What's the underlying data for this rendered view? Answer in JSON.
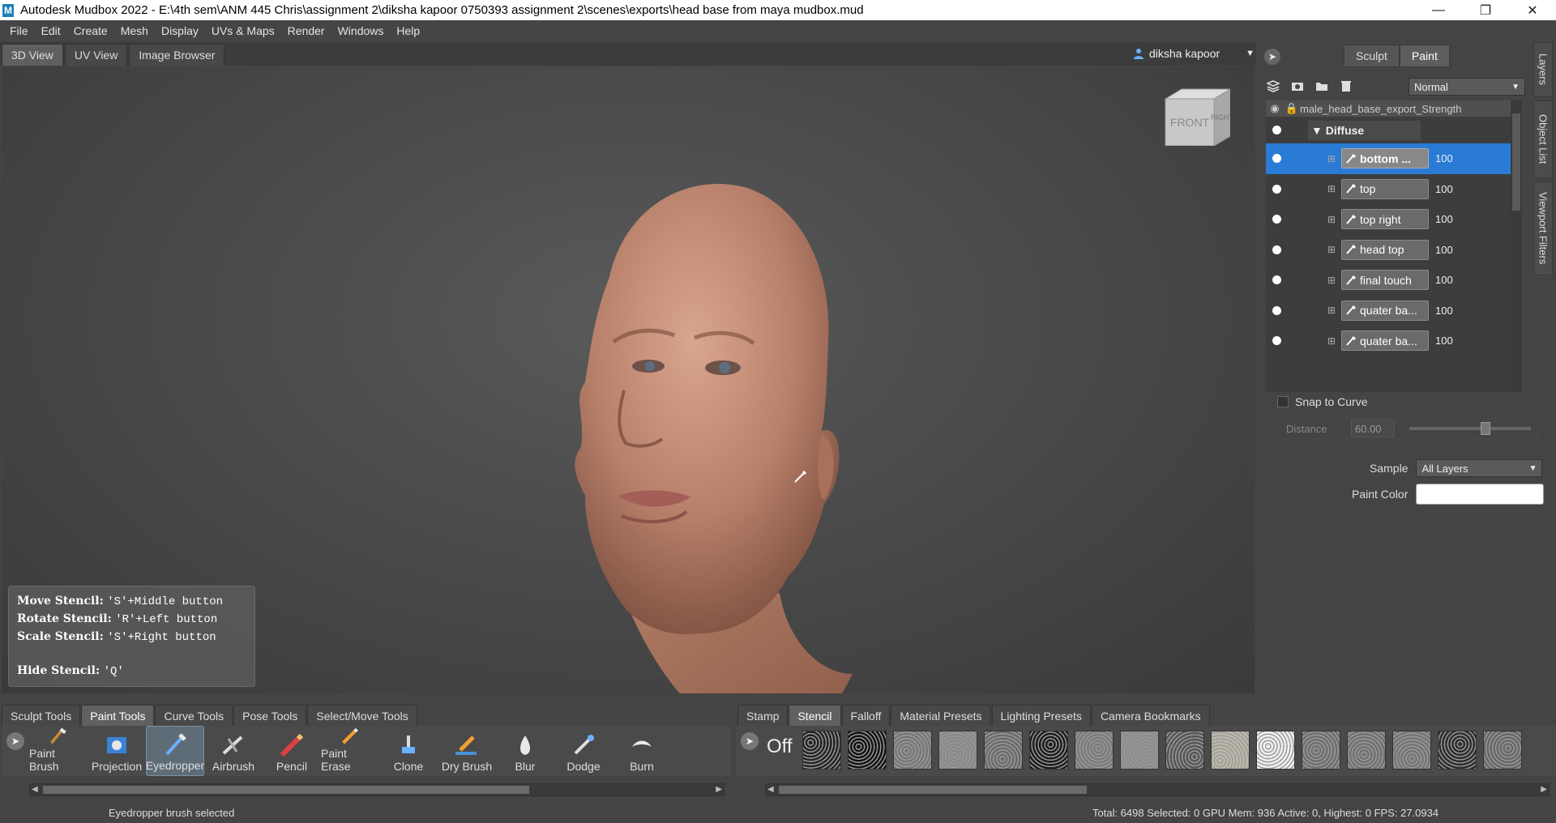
{
  "window": {
    "title": "Autodesk Mudbox 2022 - E:\\4th sem\\ANM 445 Chris\\assignment 2\\diksha kapoor 0750393 assignment 2\\scenes\\exports\\head base from maya mudbox.mud",
    "app_icon_letter": "M"
  },
  "menu": [
    "File",
    "Edit",
    "Create",
    "Mesh",
    "Display",
    "UVs & Maps",
    "Render",
    "Windows",
    "Help"
  ],
  "view_tabs": [
    "3D View",
    "UV View",
    "Image Browser"
  ],
  "user": {
    "name": "diksha kapoor"
  },
  "view_cube": {
    "front_label": "FRONT",
    "right_label": "RIGHT"
  },
  "stencil_help": {
    "move_label": "Move Stencil:",
    "move_keys": "'S'+Middle button",
    "rotate_label": "Rotate Stencil:",
    "rotate_keys": "'R'+Left button",
    "scale_label": "Scale Stencil:",
    "scale_keys": "'S'+Right button",
    "hide_label": "Hide Stencil:",
    "hide_keys": "'Q'"
  },
  "right_panel": {
    "mode_tabs": [
      "Sculpt",
      "Paint"
    ],
    "active_mode": "Paint",
    "blend_mode": "Normal",
    "layer_header": "male_head_base_export_Strength",
    "channel": "Diffuse",
    "layers": [
      {
        "name": "bottom ...",
        "value": "100",
        "selected": true
      },
      {
        "name": "top",
        "value": "100",
        "selected": false
      },
      {
        "name": "top right",
        "value": "100",
        "selected": false
      },
      {
        "name": "head top",
        "value": "100",
        "selected": false
      },
      {
        "name": "final touch",
        "value": "100",
        "selected": false
      },
      {
        "name": "quater ba...",
        "value": "100",
        "selected": false
      },
      {
        "name": "quater ba...",
        "value": "100",
        "selected": false
      }
    ],
    "snap_to_curve": "Snap to Curve",
    "distance_label": "Distance",
    "distance_value": "60.00",
    "distance_fraction": 0.6,
    "sample_label": "Sample",
    "sample_value": "All Layers",
    "paint_color_label": "Paint Color",
    "paint_color": "#ffffff"
  },
  "side_tabs": [
    "Layers",
    "Object List",
    "Viewport Filters"
  ],
  "tool_tabs": [
    "Sculpt Tools",
    "Paint Tools",
    "Curve Tools",
    "Pose Tools",
    "Select/Move Tools"
  ],
  "active_tool_tab": "Paint Tools",
  "paint_tools": [
    {
      "label": "Paint Brush",
      "icon": "paint-brush-icon"
    },
    {
      "label": "Projection",
      "icon": "projection-icon"
    },
    {
      "label": "Eyedropper",
      "icon": "eyedropper-icon"
    },
    {
      "label": "Airbrush",
      "icon": "airbrush-icon"
    },
    {
      "label": "Pencil",
      "icon": "pencil-icon"
    },
    {
      "label": "Paint Erase",
      "icon": "paint-erase-icon"
    },
    {
      "label": "Clone",
      "icon": "clone-icon"
    },
    {
      "label": "Dry Brush",
      "icon": "dry-brush-icon"
    },
    {
      "label": "Blur",
      "icon": "blur-icon"
    },
    {
      "label": "Dodge",
      "icon": "dodge-icon"
    },
    {
      "label": "Burn",
      "icon": "burn-icon"
    }
  ],
  "active_tool": "Eyedropper",
  "stamp_tabs": [
    "Stamp",
    "Stencil",
    "Falloff",
    "Material Presets",
    "Lighting Presets",
    "Camera Bookmarks"
  ],
  "active_stamp_tab": "Stencil",
  "stencil_off_label": "Off",
  "status": {
    "message": "Eyedropper brush selected",
    "stats": "Total: 6498  Selected: 0 GPU Mem: 936  Active: 0, Highest: 0  FPS: 27.0934"
  },
  "colors": {
    "accent": "#2a7bd6",
    "background": "#444444"
  }
}
